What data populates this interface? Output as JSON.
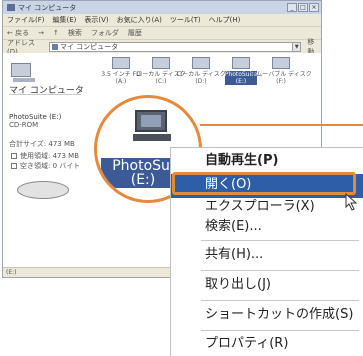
{
  "window": {
    "title": "マイ コンピュータ",
    "controls": [
      "_",
      "□",
      "×"
    ]
  },
  "menubar": [
    "ファイル(F)",
    "編集(E)",
    "表示(V)",
    "お気に入り(A)",
    "ツール(T)",
    "ヘルプ(H)"
  ],
  "toolbar": [
    "← 戻る",
    "→",
    "↑",
    "検索",
    "フォルダ",
    "履歴"
  ],
  "address": {
    "label": "アドレス(D)",
    "value": "マイ コンピュータ",
    "go_label": "移動"
  },
  "left_pane": {
    "title": "マイ コンピュータ",
    "drive_name": "PhotoSuite (E:)",
    "drive_type": "CD-ROM",
    "total_size": "合計サイズ: 473 MB",
    "used": "使用領域: 473 MB",
    "free": "空き領域: 0 バイト"
  },
  "drives": [
    {
      "label": "3.5 インチ FD\n(A:)"
    },
    {
      "label": "ローカル ディスク\n(C:)"
    },
    {
      "label": "ローカル ディスク\n(D:)"
    },
    {
      "label": "PhotoSuite\n(E:)",
      "selected": true
    },
    {
      "label": "リムーバブル ディスク\n(F:)"
    }
  ],
  "zoom": {
    "label_line1": "PhotoSui",
    "label_line2": "(E:)"
  },
  "status": "(E:)",
  "context_menu": {
    "autoplay": "自動再生(P)",
    "open": "開く(O)",
    "explorer": "エクスプローラ(X)",
    "search": "検索(E)...",
    "share": "共有(H)...",
    "eject": "取り出し(J)",
    "shortcut": "ショートカットの作成(S)",
    "properties": "プロパティ(R)"
  },
  "colors": {
    "accent": "#e48a3a",
    "highlight": "#2f5ea8"
  }
}
